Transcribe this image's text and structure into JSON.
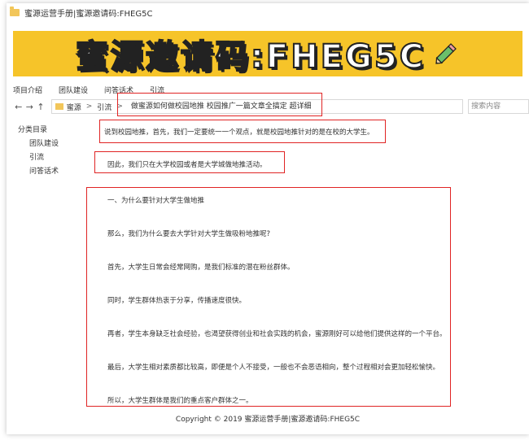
{
  "window": {
    "title": "蜜源运营手册|蜜源邀请码:FHEG5C"
  },
  "banner": {
    "text": "蜜源邀请码:FHEG5C",
    "icon": "pencil-icon"
  },
  "menu": {
    "items": [
      "项目介绍",
      "团队建设",
      "问答话术",
      "引流"
    ]
  },
  "nav": {
    "back": "←",
    "forward": "→",
    "up": "↑"
  },
  "address": {
    "crumbs": [
      "蜜源",
      "引流"
    ],
    "separator": ">",
    "value": "做蜜源如何做校园地推 校园推广一篇文章全搞定 超详细"
  },
  "search": {
    "placeholder": "搜索内容"
  },
  "tree": {
    "root": "分类目录",
    "children": [
      "团队建设",
      "引流",
      "问答话术"
    ]
  },
  "content": {
    "p1": "说到校园地推，首先，我们一定要统一一个观点，就是校园地推针对的是在校的大学生。",
    "p2": "因此，我们只在大学校园或者是大学城做地推活动。",
    "list": [
      "一、为什么要针对大学生做地推",
      "那么，我们为什么要去大学针对大学生做吸粉地推呢?",
      "首先，大学生日常会经常网购，是我们标准的潜在粉丝群体。",
      "同时，学生群体热衷于分享，传播速度很快。",
      "再者，学生本身缺乏社会经验，也渴望获得创业和社会实践的机会，蜜源刚好可以给他们提供这样的一个平台。",
      "最后，大学生相对素质都比较高，即便是个人不接受，一般也不会恶语相向，整个过程相对会更加轻松愉快。",
      "所以，大学生群体是我们的重点客户群体之一。"
    ]
  },
  "footer": {
    "text": "Copyright © 2019 蜜源运营手册|蜜源邀请码:FHEG5C"
  },
  "colors": {
    "banner": "#f6c429",
    "highlight": "#e02424",
    "folder": "#f2c65a"
  }
}
